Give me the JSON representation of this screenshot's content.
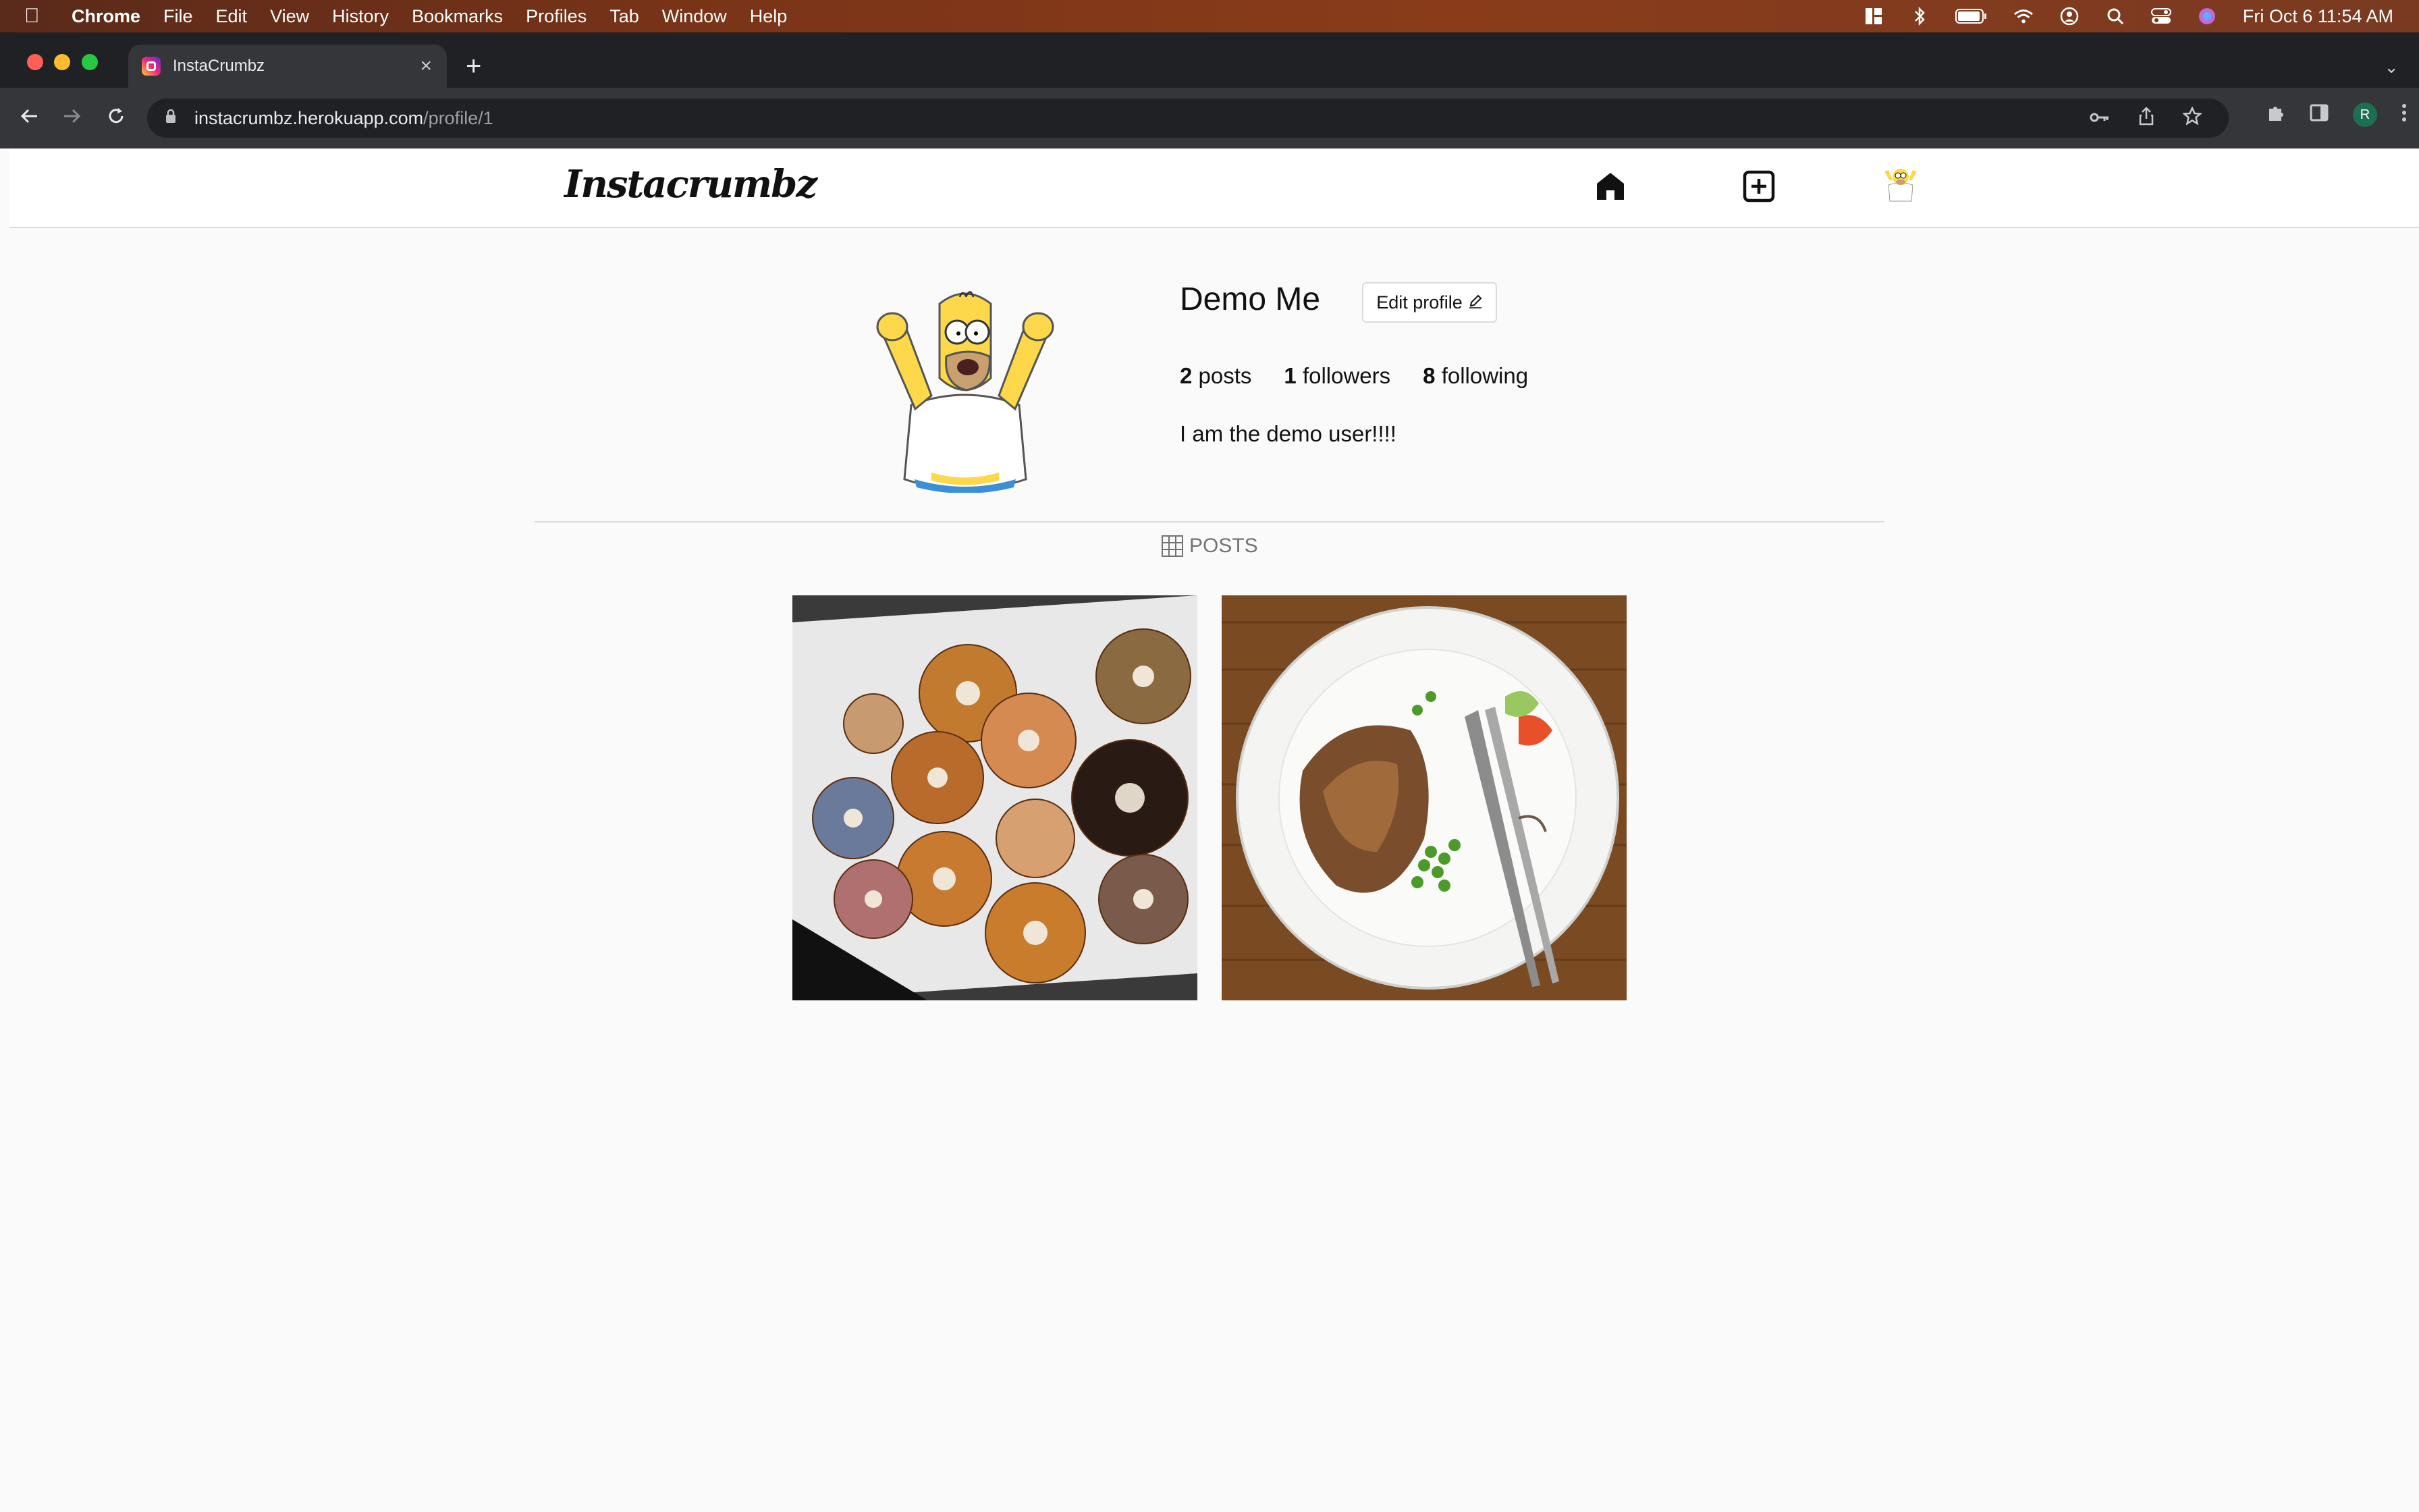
{
  "menubar": {
    "app_name": "Chrome",
    "items": [
      "File",
      "Edit",
      "View",
      "History",
      "Bookmarks",
      "Profiles",
      "Tab",
      "Window",
      "Help"
    ],
    "clock": "Fri Oct 6  11:54 AM"
  },
  "browser": {
    "tab_title": "InstaCrumbz",
    "url_host": "instacrumbz.herokuapp.com",
    "url_path": "/profile/1",
    "profile_initial": "R"
  },
  "site": {
    "logo": "Instacrumbz"
  },
  "profile": {
    "username": "Demo Me",
    "edit_button": "Edit profile",
    "posts_count": "2",
    "posts_label": "posts",
    "followers_count": "1",
    "followers_label": "followers",
    "following_count": "8",
    "following_label": "following",
    "bio": "I am the demo user!!!!"
  },
  "posts_section": {
    "tab_label": "POSTS",
    "posts": [
      {
        "subject": "donuts"
      },
      {
        "subject": "plate-of-food"
      }
    ]
  }
}
